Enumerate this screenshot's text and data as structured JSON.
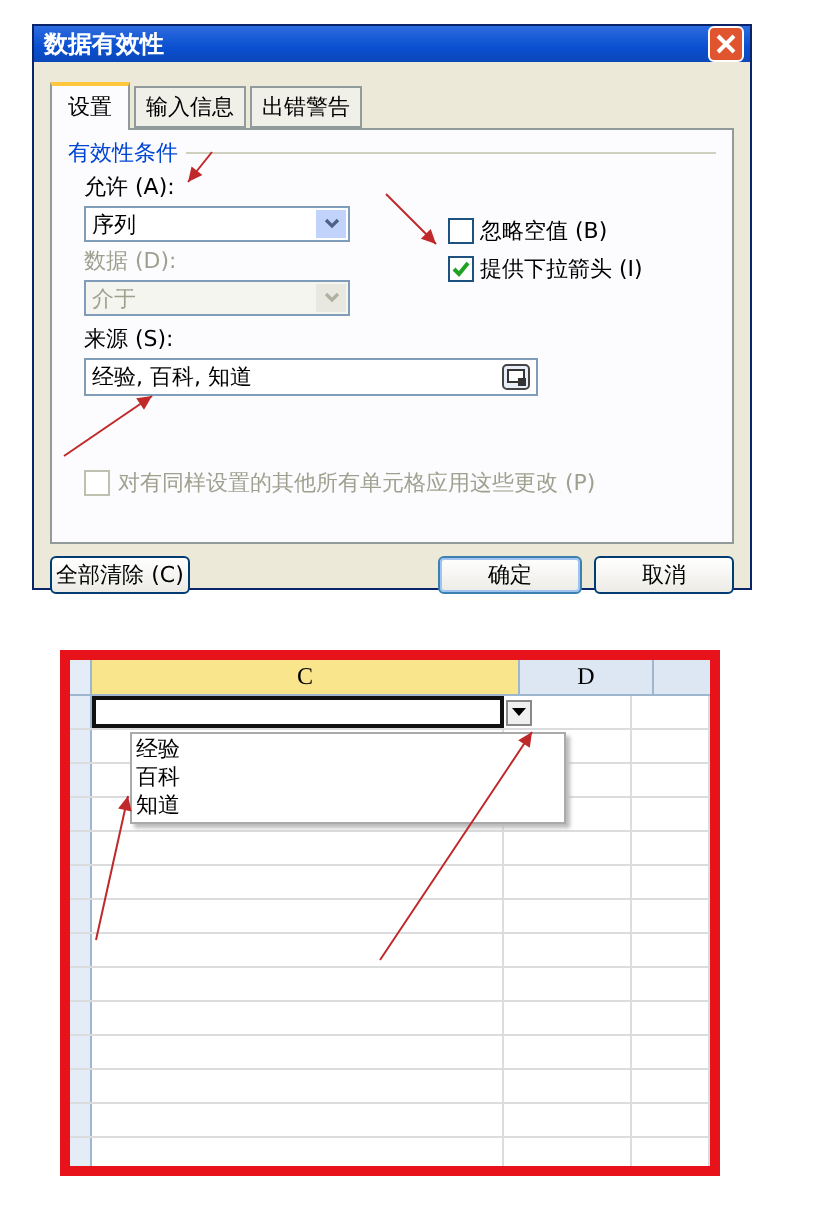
{
  "dialog": {
    "title": "数据有效性",
    "tabs": [
      {
        "label": "设置",
        "selected": true
      },
      {
        "label": "输入信息",
        "selected": false
      },
      {
        "label": "出错警告",
        "selected": false
      }
    ],
    "group_label": "有效性条件",
    "allow": {
      "label": "允许 (A):",
      "value": "序列",
      "disabled": false
    },
    "data": {
      "label": "数据 (D):",
      "value": "介于",
      "disabled": true
    },
    "checkboxes": [
      {
        "label": "忽略空值 (B)",
        "checked": false
      },
      {
        "label": "提供下拉箭头 (I)",
        "checked": true
      }
    ],
    "source": {
      "label": "来源 (S):",
      "value": "经验, 百科, 知道"
    },
    "apply_all": {
      "label": "对有同样设置的其他所有单元格应用这些更改 (P)",
      "checked": false,
      "disabled": true
    },
    "buttons": [
      {
        "label": "全部清除 (C)",
        "kind": "left",
        "selected": false
      },
      {
        "label": "确定",
        "kind": "right",
        "selected": true
      },
      {
        "label": "取消",
        "kind": "right",
        "selected": false
      }
    ]
  },
  "sheet": {
    "columns": [
      {
        "label": "C",
        "selected": true
      },
      {
        "label": "D",
        "selected": false
      }
    ],
    "dropdown_items": [
      "经验",
      "百科",
      "知道"
    ]
  }
}
